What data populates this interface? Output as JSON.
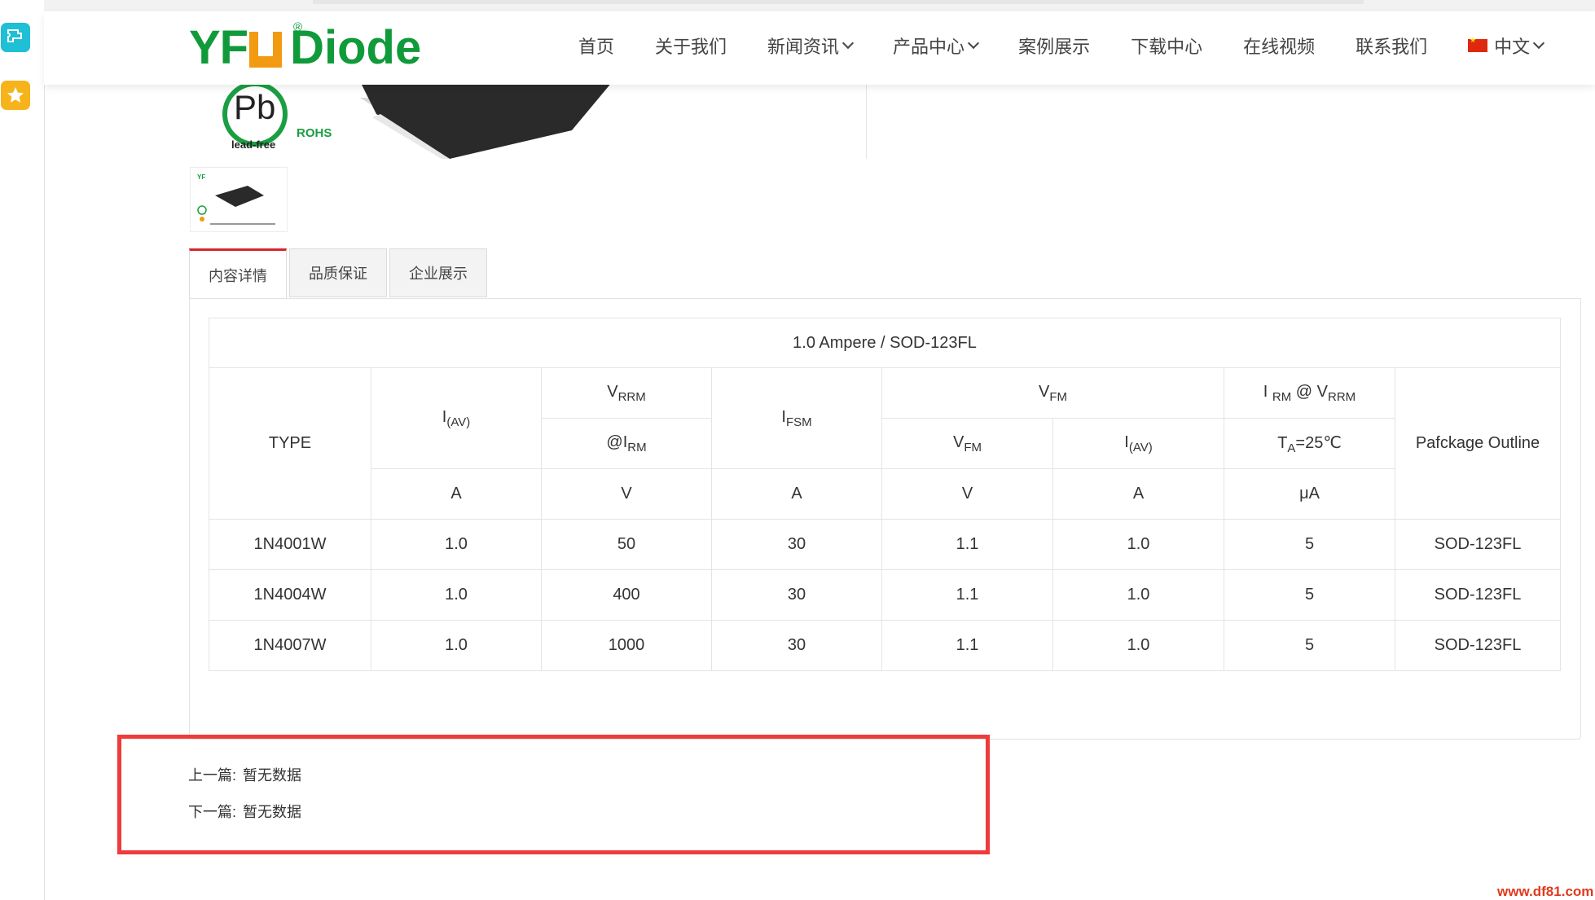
{
  "brand": {
    "logo_left": "YF",
    "logo_right": "Diode",
    "registered_mark": "®",
    "brand_green": "#109a3a",
    "brand_orange": "#f29a12"
  },
  "nav": {
    "items": [
      {
        "label": "首页",
        "dropdown": false
      },
      {
        "label": "关于我们",
        "dropdown": false
      },
      {
        "label": "新闻资讯",
        "dropdown": true
      },
      {
        "label": "产品中心",
        "dropdown": true
      },
      {
        "label": "案例展示",
        "dropdown": false
      },
      {
        "label": "下载中心",
        "dropdown": false
      },
      {
        "label": "在线视频",
        "dropdown": false
      },
      {
        "label": "联系我们",
        "dropdown": false
      }
    ],
    "language": {
      "label": "中文",
      "flag_icon": "china-flag-icon"
    }
  },
  "product_image": {
    "badge_text": "Pb",
    "rohs_text": "ROHS",
    "lead_free_text": "lead-free",
    "thumbnail_icon": "product-thumbnail"
  },
  "tabs": [
    {
      "label": "内容详情",
      "active": true
    },
    {
      "label": "品质保证",
      "active": false
    },
    {
      "label": "企业展示",
      "active": false
    }
  ],
  "spec_table": {
    "caption": "1.0   Ampere / SOD-123FL",
    "headers": {
      "type": "TYPE",
      "iav": {
        "main": "I",
        "sub": "(AV)"
      },
      "vrrm": {
        "main": "V",
        "sub": "RRM"
      },
      "at_irm": {
        "main": "@I",
        "sub": "RM"
      },
      "ifsm": {
        "main": "I",
        "sub": "FSM"
      },
      "vfm_group": {
        "main": "V",
        "sub": "FM"
      },
      "vfm": {
        "main": "V",
        "sub": "FM"
      },
      "vfm_iav": {
        "main": "I",
        "sub": "(AV)"
      },
      "irm_vrrm": {
        "main": "I ",
        "sub1": "RM",
        "mid": " @ V",
        "sub2": "RRM"
      },
      "ta": {
        "main": "T",
        "sub": "A",
        "tail": "=25℃"
      },
      "package": "Pafckage Outline"
    },
    "units": [
      "A",
      "V",
      "A",
      "V",
      "A",
      "μA"
    ],
    "rows": [
      {
        "type": "1N4001W",
        "iav": "1.0",
        "vrrm": "50",
        "ifsm": "30",
        "vfm": "1.1",
        "vfm_iav": "1.0",
        "irm": "5",
        "package": "SOD-123FL"
      },
      {
        "type": "1N4004W",
        "iav": "1.0",
        "vrrm": "400",
        "ifsm": "30",
        "vfm": "1.1",
        "vfm_iav": "1.0",
        "irm": "5",
        "package": "SOD-123FL"
      },
      {
        "type": "1N4007W",
        "iav": "1.0",
        "vrrm": "1000",
        "ifsm": "30",
        "vfm": "1.1",
        "vfm_iav": "1.0",
        "irm": "5",
        "package": "SOD-123FL"
      }
    ]
  },
  "prev_next": {
    "prev_label": "上一篇:",
    "prev_value": "暂无数据",
    "next_label": "下一篇:",
    "next_value": "暂无数据"
  },
  "watermark": "www.df81.com",
  "accent_red": "#d6262c",
  "highlight_color": "#ee3b3b"
}
